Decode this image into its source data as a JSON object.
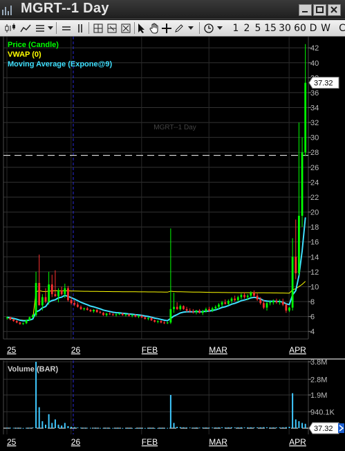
{
  "window": {
    "title": "MGRT--1 Day"
  },
  "toolbar": {
    "intervals": [
      "1",
      "2",
      "5",
      "15",
      "30",
      "60",
      "D",
      "W"
    ],
    "partial_button": "C"
  },
  "chart_data": [
    {
      "type": "candlestick",
      "title": "MGRT--1 Day",
      "legend": [
        "Price (Candle)",
        "VWAP (0)",
        "Moving Average (Expone@9)"
      ],
      "legend_colors": [
        "#00ff00",
        "#ffff00",
        "#3fe0ff"
      ],
      "x_tick_labels": [
        "25",
        "26",
        "FEB",
        "MAR",
        "APR"
      ],
      "y_tick_labels": [
        "4",
        "6",
        "8",
        "10",
        "12",
        "14",
        "16",
        "18",
        "20",
        "22",
        "24",
        "26",
        "28",
        "30",
        "32",
        "34",
        "36",
        "38",
        "40",
        "42"
      ],
      "ylim": [
        3,
        43.5
      ],
      "last_price": "37.32",
      "dashed_level": 27.6,
      "up_color": "#00ff00",
      "down_color": "#ff3030",
      "candles_ohlc": [
        [
          5.8,
          6.0,
          5.6,
          5.9
        ],
        [
          5.9,
          5.95,
          5.5,
          5.6
        ],
        [
          5.6,
          5.7,
          5.3,
          5.4
        ],
        [
          5.4,
          5.5,
          5.1,
          5.2
        ],
        [
          5.2,
          5.3,
          4.9,
          5.0
        ],
        [
          5.0,
          5.2,
          4.9,
          5.1
        ],
        [
          5.1,
          5.6,
          5.0,
          5.5
        ],
        [
          5.5,
          6.0,
          5.4,
          5.9
        ],
        [
          5.9,
          6.3,
          5.8,
          6.2
        ],
        [
          6.2,
          12.0,
          6.0,
          10.5
        ],
        [
          10.5,
          14.3,
          8.0,
          7.5
        ],
        [
          7.5,
          9.0,
          6.8,
          8.6
        ],
        [
          8.6,
          9.8,
          7.8,
          8.0
        ],
        [
          8.0,
          12.0,
          7.6,
          10.3
        ],
        [
          10.3,
          11.6,
          8.6,
          9.0
        ],
        [
          9.0,
          12.2,
          8.8,
          8.7
        ],
        [
          8.7,
          9.8,
          7.9,
          9.5
        ],
        [
          9.5,
          10.0,
          8.8,
          9.0
        ],
        [
          9.0,
          10.4,
          8.5,
          9.8
        ],
        [
          9.8,
          10.1,
          8.0,
          8.2
        ],
        [
          8.2,
          8.6,
          7.6,
          7.8
        ],
        [
          7.8,
          8.2,
          7.4,
          7.6
        ],
        [
          7.6,
          7.9,
          7.2,
          7.3
        ],
        [
          7.3,
          7.5,
          6.9,
          7.0
        ],
        [
          7.0,
          7.2,
          6.8,
          7.1
        ],
        [
          7.1,
          7.3,
          6.8,
          6.9
        ],
        [
          6.9,
          7.0,
          6.6,
          6.7
        ],
        [
          6.7,
          7.0,
          6.5,
          6.9
        ],
        [
          6.9,
          7.0,
          6.5,
          6.6
        ],
        [
          6.6,
          6.8,
          6.4,
          6.5
        ],
        [
          6.5,
          6.6,
          6.1,
          6.2
        ],
        [
          6.2,
          6.5,
          6.0,
          6.4
        ],
        [
          6.4,
          6.6,
          6.2,
          6.3
        ],
        [
          6.3,
          6.5,
          6.1,
          6.2
        ],
        [
          6.2,
          6.4,
          6.0,
          6.3
        ],
        [
          6.3,
          6.5,
          6.2,
          6.4
        ],
        [
          6.4,
          6.5,
          6.1,
          6.2
        ],
        [
          6.2,
          6.4,
          6.0,
          6.3
        ],
        [
          6.3,
          6.4,
          6.0,
          6.1
        ],
        [
          6.1,
          6.3,
          5.9,
          6.2
        ],
        [
          6.2,
          6.3,
          5.9,
          6.0
        ],
        [
          6.0,
          6.2,
          5.8,
          6.1
        ],
        [
          6.1,
          6.2,
          5.8,
          5.9
        ],
        [
          5.9,
          6.0,
          5.6,
          5.7
        ],
        [
          5.7,
          5.9,
          5.5,
          5.8
        ],
        [
          5.8,
          5.9,
          5.4,
          5.5
        ],
        [
          5.5,
          5.6,
          5.2,
          5.3
        ],
        [
          5.3,
          5.5,
          5.1,
          5.4
        ],
        [
          5.4,
          5.5,
          5.1,
          5.2
        ],
        [
          5.2,
          5.4,
          5.0,
          5.1
        ],
        [
          5.1,
          5.3,
          5.0,
          5.2
        ],
        [
          5.2,
          17.8,
          5.0,
          7.0
        ],
        [
          7.0,
          9.2,
          6.5,
          7.3
        ],
        [
          7.3,
          7.9,
          6.9,
          7.0
        ],
        [
          7.0,
          7.6,
          6.8,
          7.4
        ],
        [
          7.4,
          7.5,
          6.9,
          7.0
        ],
        [
          7.0,
          7.3,
          6.6,
          6.8
        ],
        [
          6.8,
          7.1,
          6.5,
          6.7
        ],
        [
          6.7,
          7.0,
          6.4,
          6.6
        ],
        [
          6.6,
          6.9,
          6.3,
          6.8
        ],
        [
          6.8,
          7.0,
          6.4,
          6.5
        ],
        [
          6.5,
          6.9,
          6.2,
          6.7
        ],
        [
          6.7,
          7.2,
          6.5,
          7.0
        ],
        [
          7.0,
          7.3,
          6.6,
          6.8
        ],
        [
          6.8,
          7.3,
          6.6,
          7.1
        ],
        [
          7.1,
          7.5,
          6.9,
          7.3
        ],
        [
          7.3,
          7.8,
          7.0,
          7.6
        ],
        [
          7.6,
          8.1,
          7.3,
          7.9
        ],
        [
          7.9,
          8.3,
          7.6,
          7.7
        ],
        [
          7.7,
          8.3,
          7.5,
          8.1
        ],
        [
          8.1,
          8.6,
          7.8,
          8.4
        ],
        [
          8.4,
          8.8,
          8.0,
          8.2
        ],
        [
          8.2,
          8.8,
          8.0,
          8.6
        ],
        [
          8.6,
          9.1,
          8.3,
          8.9
        ],
        [
          8.9,
          9.2,
          8.4,
          8.6
        ],
        [
          8.6,
          9.0,
          8.2,
          8.8
        ],
        [
          8.8,
          9.4,
          8.5,
          9.2
        ],
        [
          9.2,
          9.5,
          8.6,
          8.8
        ],
        [
          8.8,
          9.1,
          8.1,
          8.3
        ],
        [
          8.3,
          8.6,
          7.6,
          7.8
        ],
        [
          7.8,
          8.2,
          7.0,
          7.2
        ],
        [
          7.2,
          8.0,
          6.8,
          7.8
        ],
        [
          7.8,
          8.2,
          7.5,
          7.9
        ],
        [
          7.9,
          8.3,
          7.6,
          8.1
        ],
        [
          8.1,
          8.4,
          7.7,
          7.9
        ],
        [
          7.9,
          8.3,
          7.6,
          8.0
        ],
        [
          8.0,
          8.4,
          7.4,
          7.6
        ],
        [
          7.6,
          7.8,
          6.5,
          6.8
        ],
        [
          6.8,
          7.3,
          6.6,
          7.2
        ],
        [
          7.2,
          16.5,
          6.8,
          14.0
        ],
        [
          14.0,
          19.0,
          11.0,
          11.8
        ],
        [
          11.8,
          32.0,
          11.5,
          19.5
        ],
        [
          19.5,
          30.0,
          18.0,
          28.0
        ],
        [
          28.0,
          42.5,
          27.5,
          37.32
        ]
      ]
    },
    {
      "type": "bar",
      "title": "Volume (BAR)",
      "color": "#3fc8ff",
      "x_tick_labels": [
        "25",
        "26",
        "FEB",
        "MAR",
        "APR"
      ],
      "y_tick_labels": [
        "3.8M",
        "2.8M",
        "1.9M",
        "940.1K"
      ],
      "ylim": [
        0,
        3800000
      ],
      "last_value": "37.32",
      "values": [
        30000,
        25000,
        20000,
        15000,
        12000,
        10000,
        15000,
        25000,
        40000,
        3800000,
        1200000,
        400000,
        200000,
        800000,
        300000,
        500000,
        200000,
        150000,
        300000,
        120000,
        80000,
        60000,
        40000,
        30000,
        25000,
        20000,
        18000,
        20000,
        15000,
        14000,
        12000,
        15000,
        10000,
        12000,
        10000,
        12000,
        10000,
        9000,
        8000,
        10000,
        8000,
        9000,
        8000,
        10000,
        8000,
        9000,
        8000,
        10000,
        8000,
        9000,
        15000,
        1900000,
        300000,
        80000,
        60000,
        50000,
        40000,
        35000,
        30000,
        40000,
        30000,
        35000,
        40000,
        30000,
        35000,
        40000,
        45000,
        50000,
        40000,
        45000,
        50000,
        40000,
        45000,
        50000,
        40000,
        45000,
        50000,
        40000,
        45000,
        50000,
        60000,
        50000,
        40000,
        45000,
        40000,
        45000,
        50000,
        60000,
        80000,
        2000000,
        500000,
        400000,
        300000,
        250000
      ]
    }
  ]
}
